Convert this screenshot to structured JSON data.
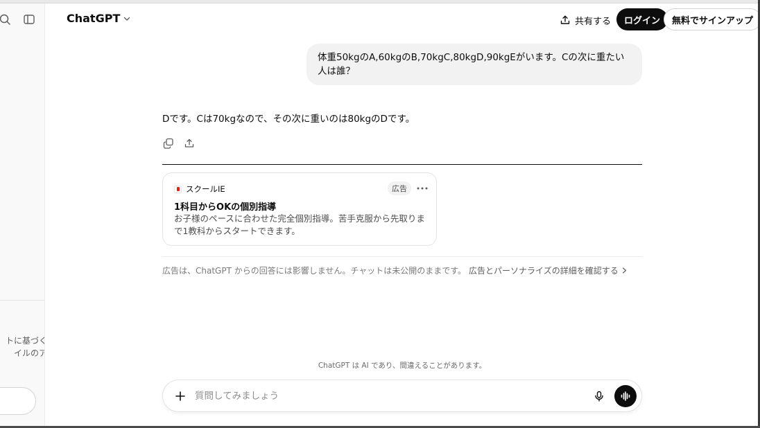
{
  "app": {
    "model_name": "ChatGPT"
  },
  "header": {
    "share_label": "共有する",
    "login_label": "ログイン",
    "signup_label": "無料でサインアップ"
  },
  "sidebar": {
    "promo_line_1": "トに基づく",
    "promo_line_2": "イルのア"
  },
  "conversation": {
    "user_message": "体重50kgのA,60kgのB,70kgC,80kgD,90kgEがいます。Cの次に重たい人は誰？",
    "assistant_message": "Dです。Cは70kgなので、その次に重いのは80kgのDです。"
  },
  "ad": {
    "brand": "スクールIE",
    "badge": "広告",
    "title": "1科目からOKの個別指導",
    "description": "お子様のペースに合わせた完全個別指導。苦手克服から先取りまで1教科からスタートできます。",
    "notice": "広告は、ChatGPT からの回答には影響しません。チャットは未公開のままです。",
    "notice_link": "広告とパーソナライズの詳細を確認する"
  },
  "composer": {
    "placeholder": "質問してみましょう",
    "disclaimer": "ChatGPT は AI であり、間違えることがあります。"
  },
  "colors": {
    "text": "#0d0d0d",
    "bubble": "#f2f2f2",
    "muted": "#7a7a7a",
    "ad_favicon": "#d9261c"
  }
}
